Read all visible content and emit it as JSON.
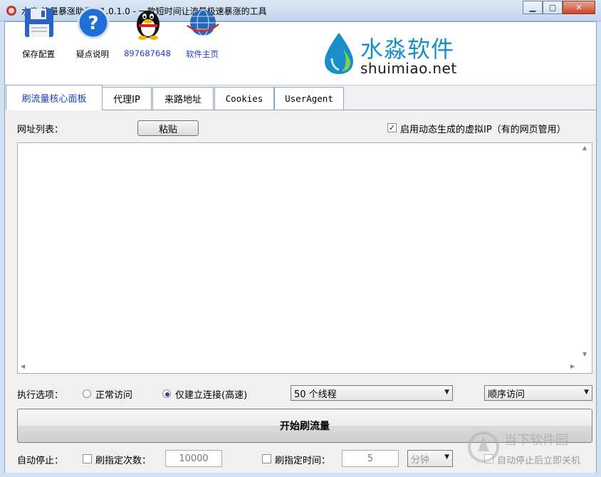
{
  "window": {
    "title": "水淼·流量暴涨助手 v1.0.1.0 - 一款短时间让流量极速暴涨的工具",
    "buttons": {
      "minimize": "▁",
      "maximize": "▢",
      "close": "✕"
    }
  },
  "toolbar": {
    "items": [
      {
        "label": "保存配置",
        "icon": "floppy-disk-icon"
      },
      {
        "label": "疑点说明",
        "icon": "help-icon"
      },
      {
        "label": "897687648",
        "icon": "qq-penguin-icon"
      },
      {
        "label": "软件主页",
        "icon": "globe-icon"
      }
    ]
  },
  "logo": {
    "name_cn": "水淼软件",
    "domain": "shuimiao.net"
  },
  "tabs": [
    {
      "label": "刷流量核心面板",
      "active": true
    },
    {
      "label": "代理IP",
      "active": false
    },
    {
      "label": "来路地址",
      "active": false
    },
    {
      "label": "Cookies",
      "active": false
    },
    {
      "label": "UserAgent",
      "active": false
    }
  ],
  "panel": {
    "url_list_label": "网址列表：",
    "paste_button": "粘贴",
    "virtual_ip_checkbox": {
      "label": "启用动态生成的虚拟IP（有的网页管用）",
      "checked": true
    },
    "url_list_value": "",
    "exec_label": "执行选项：",
    "radio_normal": {
      "label": "正常访问",
      "checked": false
    },
    "radio_connect": {
      "label": "仅建立连接(高速)",
      "checked": true
    },
    "threads_select": "50 个线程",
    "order_select": "顺序访问",
    "start_button": "开始刷流量",
    "auto_stop_label": "自动停止：",
    "count_checkbox": {
      "label": "刷指定次数：",
      "checked": false
    },
    "count_value": "10000",
    "time_checkbox": {
      "label": "刷指定时间：",
      "checked": false
    },
    "time_value": "5",
    "time_unit_select": "分钟",
    "shutdown_checkbox": {
      "label": "自动停止后立即关机",
      "checked": false
    }
  },
  "watermark": {
    "text": "当下软件园"
  },
  "colors": {
    "accent_blue": "#1d3fb8",
    "logo_blue": "#1a8ec9",
    "title_bar": "#c4d7ee"
  }
}
